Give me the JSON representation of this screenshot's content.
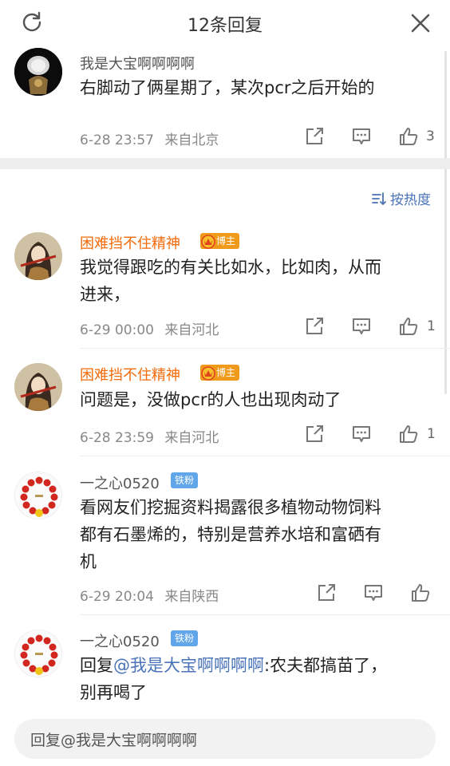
{
  "header": {
    "title": "12条回复",
    "refresh_icon": "refresh-icon",
    "close_icon": "close-icon"
  },
  "root_comment": {
    "username": "我是大宝啊啊啊啊",
    "text": "右脚动了俩星期了，某次pcr之后开始的",
    "time": "6-28 23:57",
    "location": "来自北京",
    "likes": "3"
  },
  "sort": {
    "label": "按热度",
    "icon": "sort-icon"
  },
  "replies": [
    {
      "username": "困难挡不住精神",
      "badge": "博主",
      "text_line1": "我觉得跟吃的有关比如水，比如肉，从而",
      "text_line2": "进来，",
      "time": "6-29 00:00",
      "location": "来自河北",
      "likes": "1"
    },
    {
      "username": "困难挡不住精神",
      "badge": "博主",
      "text_line1": "问题是，没做pcr的人也出现肉动了",
      "time": "6-28 23:59",
      "location": "来自河北",
      "likes": "1"
    },
    {
      "username": "一之心0520",
      "badge": "铁粉",
      "text_line1": "看网友们挖掘资料揭露很多植物动物饲料",
      "text_line2": "都有石墨烯的，特别是营养水培和富硒有",
      "text_line3": "机",
      "time": "6-29 20:04",
      "location": "来自陕西",
      "likes": ""
    },
    {
      "username": "一之心0520",
      "badge": "铁粉",
      "reply_prefix": "回复",
      "mention": "@我是大宝啊啊啊啊",
      "text_after": ":农夫都搞苗了，",
      "text_line2": "别再喝了"
    }
  ],
  "reply_bar": {
    "placeholder": "回复@我是大宝啊啊啊啊"
  },
  "colors": {
    "accent_blue": "#4a73b8",
    "blogger_orange": "#f26a09",
    "badge_orange": "#f09a1c",
    "badge_blue": "#60a6e8"
  }
}
